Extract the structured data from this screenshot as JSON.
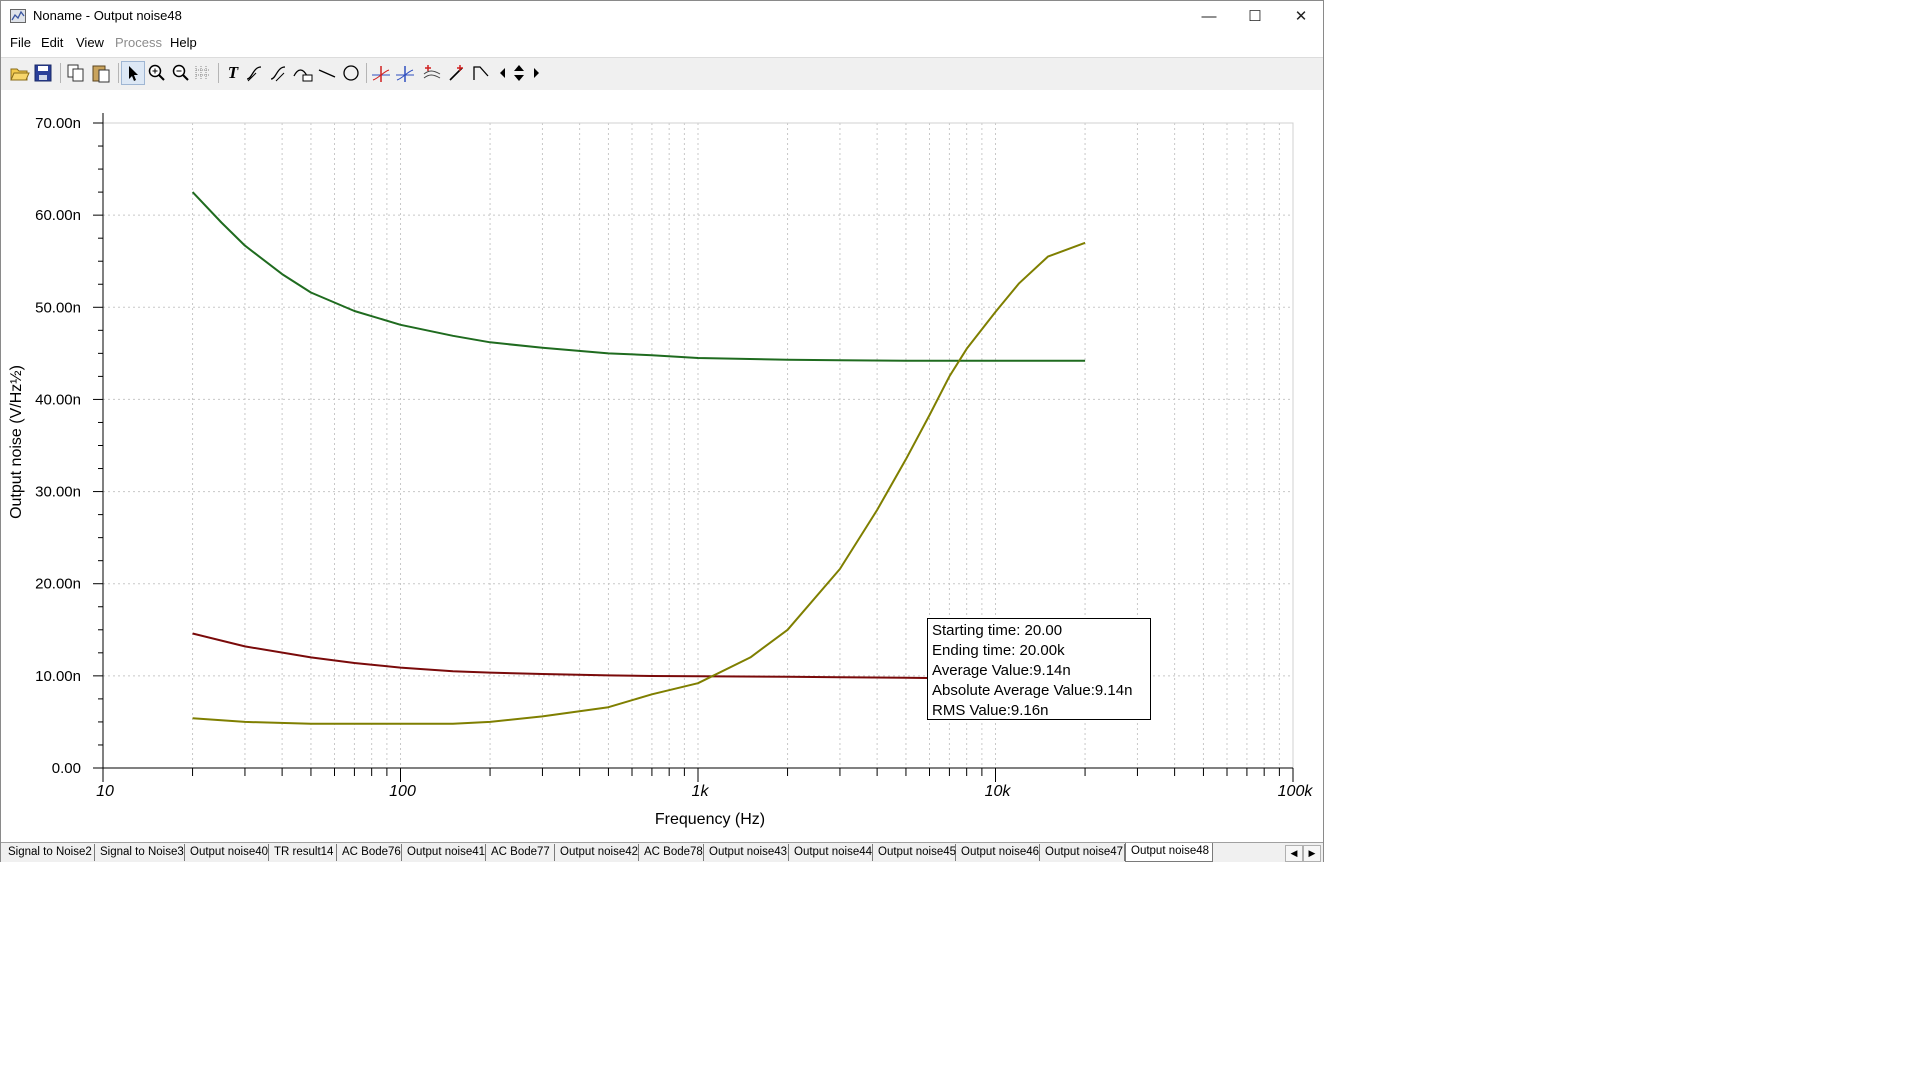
{
  "window": {
    "title": "Noname - Output noise48",
    "minimize_glyph": "—",
    "maximize_glyph": "☐",
    "close_glyph": "✕"
  },
  "menu": [
    {
      "label": "File",
      "enabled": true
    },
    {
      "label": "Edit",
      "enabled": true
    },
    {
      "label": "View",
      "enabled": true
    },
    {
      "label": "Process",
      "enabled": false
    },
    {
      "label": "Help",
      "enabled": true
    }
  ],
  "toolbar": {
    "icons": [
      "open-icon",
      "save-icon",
      "copy-icon",
      "paste-icon",
      "pointer-icon",
      "zoom-in-icon",
      "zoom-out-icon",
      "grid-icon",
      "text-icon",
      "cursor-a-icon",
      "cursor-b-icon",
      "curve-label-icon",
      "line-icon",
      "ellipse-icon",
      "marker-a-icon",
      "marker-b-icon",
      "auto-label-icon",
      "probe-icon",
      "step-icon",
      "scroll-left-icon",
      "scroll-up-down-icon",
      "scroll-right-icon"
    ],
    "text_tool_glyph": "T"
  },
  "colors": {
    "series_green": "#1f6b1f",
    "series_darkred": "#7a0a0a",
    "series_olive": "#7f7f00",
    "grid": "#c8c8c8"
  },
  "chart_data": {
    "type": "line",
    "xlabel": "Frequency (Hz)",
    "ylabel": "Output noise (V/Hz½)",
    "x_scale": "log",
    "xlim": [
      10,
      100000
    ],
    "ylim": [
      0,
      7e-08
    ],
    "x_tick_labels": [
      "10",
      "100",
      "1k",
      "10k",
      "100k"
    ],
    "x_ticks": [
      10,
      100,
      1000,
      10000,
      100000
    ],
    "y_tick_labels": [
      "0.00",
      "10.00n",
      "20.00n",
      "30.00n",
      "40.00n",
      "50.00n",
      "60.00n",
      "70.00n"
    ],
    "y_ticks": [
      0,
      1e-08,
      2e-08,
      3e-08,
      4e-08,
      5e-08,
      6e-08,
      7e-08
    ],
    "grid": true,
    "series": [
      {
        "color_key": "series_green",
        "x": [
          20,
          25,
          30,
          40,
          50,
          70,
          100,
          150,
          200,
          300,
          500,
          700,
          1000,
          2000,
          3000,
          5000,
          7000,
          10000,
          20000
        ],
        "y": [
          6.25e-08,
          5.92e-08,
          5.67e-08,
          5.36e-08,
          5.16e-08,
          4.96e-08,
          4.81e-08,
          4.69e-08,
          4.62e-08,
          4.56e-08,
          4.5e-08,
          4.48e-08,
          4.45e-08,
          4.43e-08,
          4.425e-08,
          4.42e-08,
          4.42e-08,
          4.42e-08,
          4.42e-08
        ]
      },
      {
        "color_key": "series_darkred",
        "x": [
          20,
          30,
          50,
          70,
          100,
          150,
          200,
          300,
          500,
          700,
          1000,
          2000,
          3000,
          5000,
          7000,
          10000,
          20000
        ],
        "y": [
          1.46e-08,
          1.32e-08,
          1.2e-08,
          1.14e-08,
          1.09e-08,
          1.05e-08,
          1.035e-08,
          1.02e-08,
          1.005e-08,
          9.98e-09,
          9.95e-09,
          9.9e-09,
          9.85e-09,
          9.8e-09,
          9.75e-09,
          9.7e-09,
          9.6e-09
        ]
      },
      {
        "color_key": "series_olive",
        "x": [
          20,
          30,
          50,
          100,
          150,
          200,
          300,
          500,
          700,
          1000,
          1500,
          2000,
          3000,
          4000,
          5000,
          6000,
          7000,
          8000,
          10000,
          12000,
          15000,
          20000
        ],
        "y": [
          5.4e-09,
          5e-09,
          4.8e-09,
          4.8e-09,
          4.8e-09,
          5e-09,
          5.6e-09,
          6.6e-09,
          8e-09,
          9.2e-09,
          1.2e-08,
          1.5e-08,
          2.16e-08,
          2.8e-08,
          3.35e-08,
          3.83e-08,
          4.25e-08,
          4.55e-08,
          4.95e-08,
          5.26e-08,
          5.55e-08,
          5.7e-08
        ]
      }
    ]
  },
  "info_box": {
    "starting_time": "Starting time: 20.00",
    "ending_time": "Ending time: 20.00k",
    "average": "Average Value:9.14n",
    "absolute_average": "Absolute Average Value:9.14n",
    "rms": "RMS Value:9.16n"
  },
  "tabs": [
    "Signal to Noise2",
    "Signal to Noise3",
    "Output noise40",
    "TR result14",
    "AC Bode76",
    "Output noise41",
    "AC Bode77",
    "Output noise42",
    "AC Bode78",
    "Output noise43",
    "Output noise44",
    "Output noise45",
    "Output noise46",
    "Output noise47",
    "Output noise48"
  ],
  "active_tab": "Output noise48",
  "tab_nav": {
    "left": "◀",
    "right": "▶"
  }
}
